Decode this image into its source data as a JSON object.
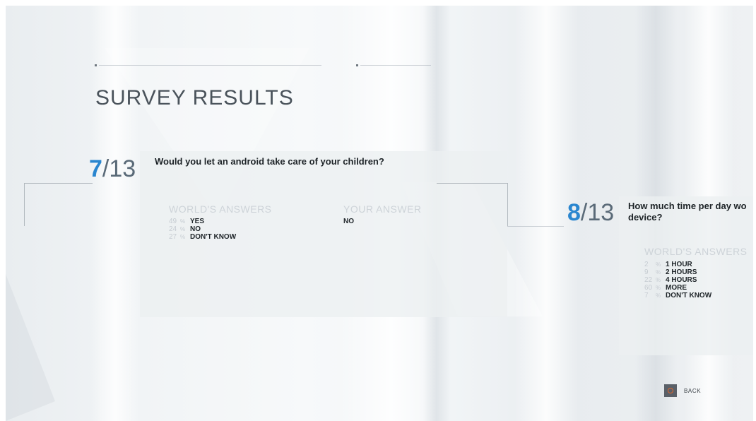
{
  "page": {
    "title": "SURVEY RESULTS"
  },
  "questions": [
    {
      "current": "7",
      "separator": "/",
      "total": "13",
      "text": "Would you let an android take care of your children?",
      "worlds_header": "WORLD'S ANSWERS",
      "answers": [
        {
          "count": "49",
          "tick": "%",
          "label": "YES"
        },
        {
          "count": "24",
          "tick": "%",
          "label": "NO"
        },
        {
          "count": "27",
          "tick": "%",
          "label": "DON'T KNOW"
        }
      ],
      "your_header": "YOUR ANSWER",
      "your_answer": "NO"
    },
    {
      "current": "8",
      "separator": "/",
      "total": "13",
      "text_line1": "How much time per day wo",
      "text_line2": "device?",
      "worlds_header": "WORLD'S ANSWERS",
      "answers": [
        {
          "count": "2",
          "tick": "%",
          "label": "1 HOUR"
        },
        {
          "count": "9",
          "tick": "%",
          "label": "2 HOURS"
        },
        {
          "count": "22",
          "tick": "%",
          "label": "4 HOURS"
        },
        {
          "count": "60",
          "tick": "%",
          "label": "MORE"
        },
        {
          "count": "7",
          "tick": "%",
          "label": "DON'T KNOW"
        }
      ]
    }
  ],
  "footer": {
    "back_icon": "circle-button-icon",
    "back_label": "BACK"
  },
  "colors": {
    "accent": "#2a86cf",
    "back_circle": "#e0672f"
  }
}
